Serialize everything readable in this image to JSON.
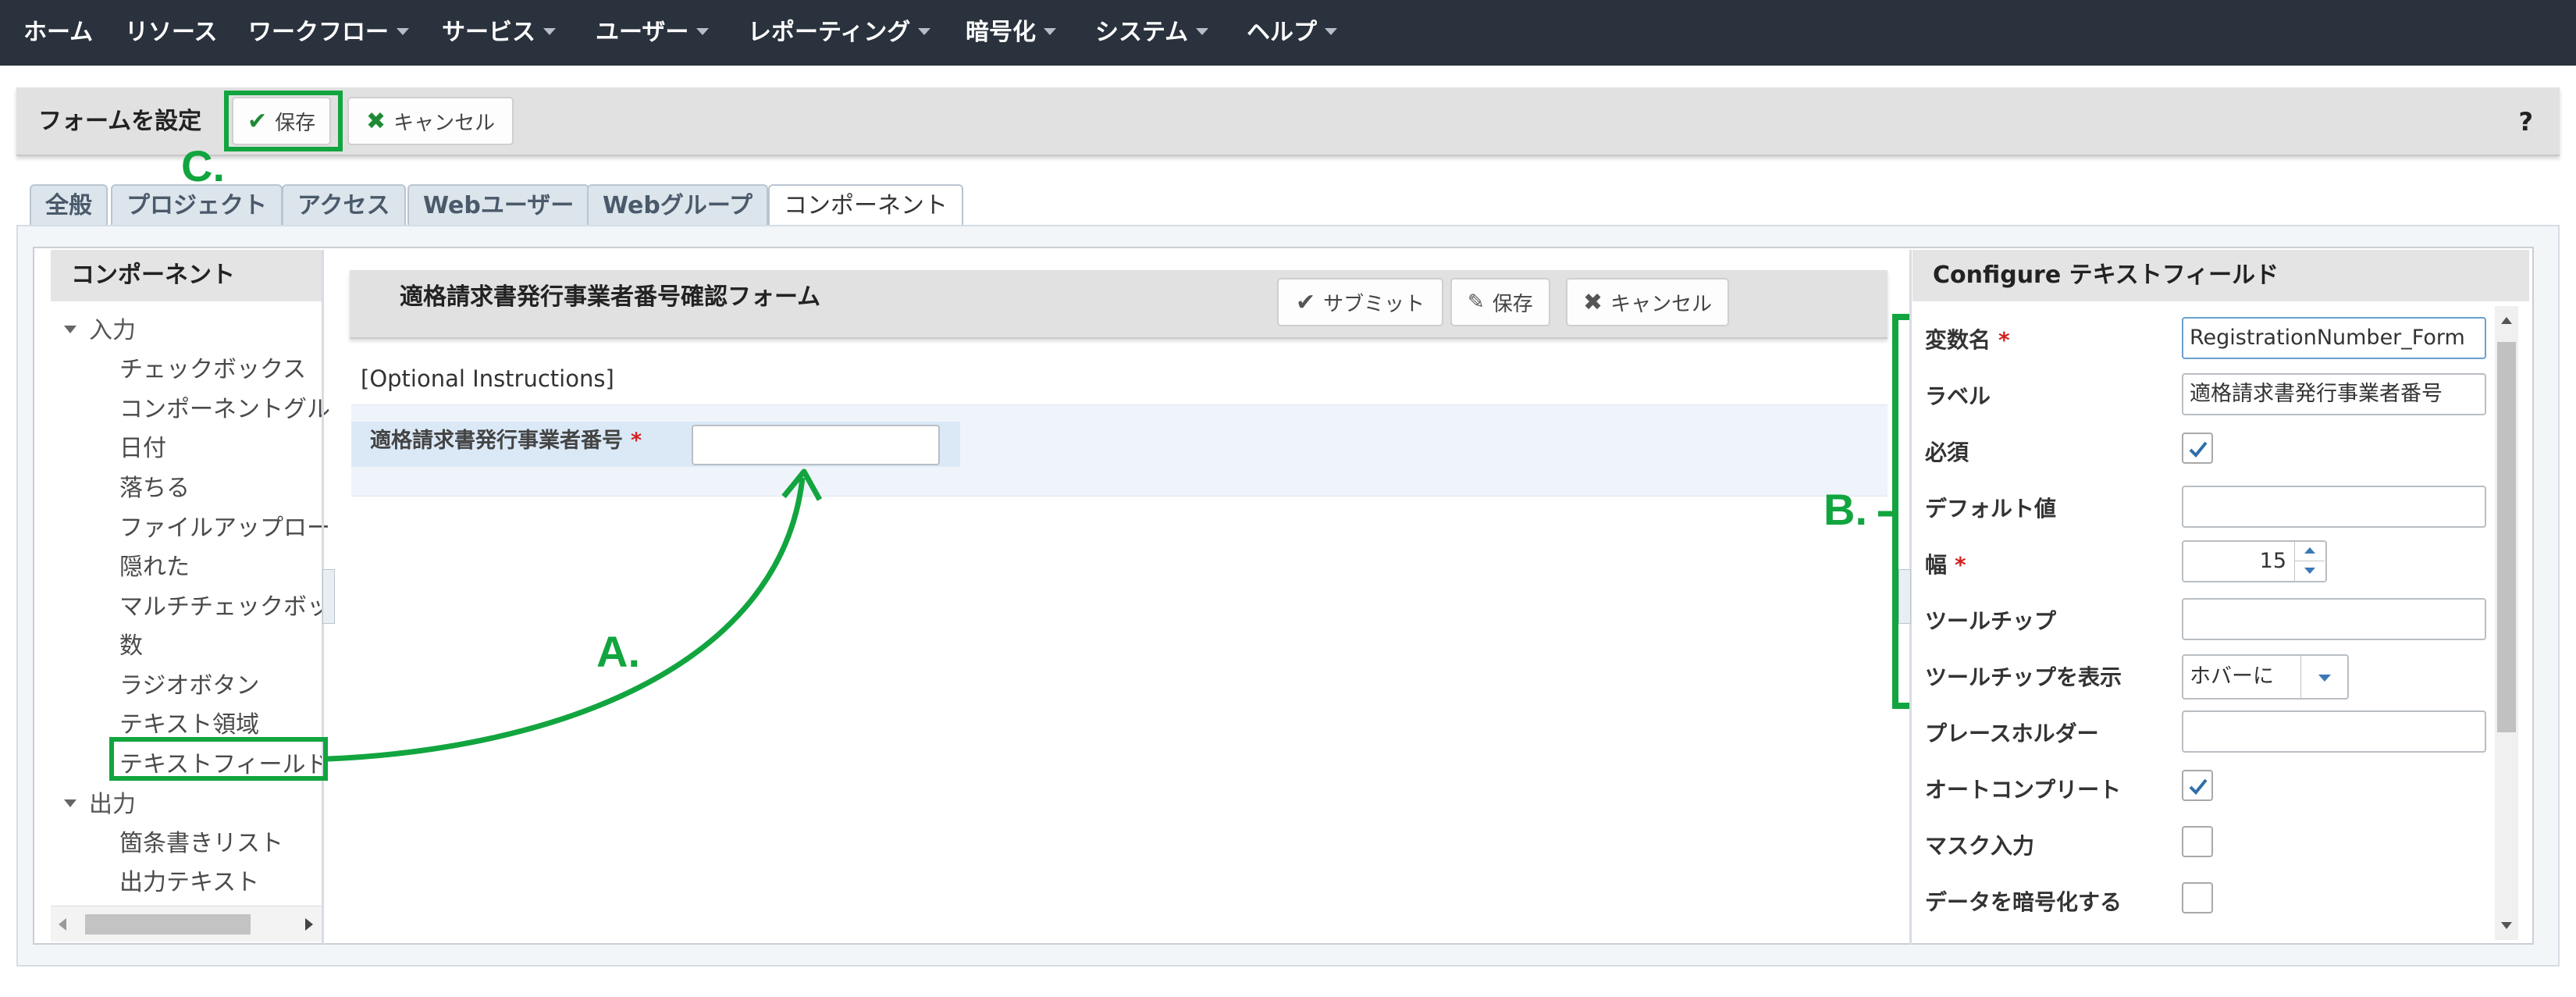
{
  "nav": {
    "items": [
      {
        "label": "ホーム",
        "dropdown": false
      },
      {
        "label": "リソース",
        "dropdown": false
      },
      {
        "label": "ワークフロー",
        "dropdown": true
      },
      {
        "label": "サービス",
        "dropdown": true
      },
      {
        "label": "ユーザー",
        "dropdown": true
      },
      {
        "label": "レポーティング",
        "dropdown": true
      },
      {
        "label": "暗号化",
        "dropdown": true
      },
      {
        "label": "システム",
        "dropdown": true
      },
      {
        "label": "ヘルプ",
        "dropdown": true
      }
    ]
  },
  "toolbar": {
    "title": "フォームを設定",
    "save_label": "保存",
    "cancel_label": "キャンセル",
    "help": "?"
  },
  "tabs": [
    {
      "label": "全般",
      "active": false
    },
    {
      "label": "プロジェクト",
      "active": false
    },
    {
      "label": "アクセス",
      "active": false
    },
    {
      "label": "Webユーザー",
      "active": false
    },
    {
      "label": "Webグループ",
      "active": false
    },
    {
      "label": "コンポーネント",
      "active": true
    }
  ],
  "components": {
    "header": "コンポーネント",
    "groups": [
      {
        "label": "入力",
        "items": [
          "チェックボックス",
          "コンポーネントグル",
          "日付",
          "落ちる",
          "ファイルアップロー",
          "隠れた",
          "マルチチェックボッ",
          "数",
          "ラジオボタン",
          "テキスト領域",
          "テキストフィールド"
        ]
      },
      {
        "label": "出力",
        "items": [
          "箇条書きリスト",
          "出力テキスト"
        ]
      }
    ]
  },
  "form": {
    "title": "適格請求書発行事業者番号確認フォーム",
    "submit_label": "サブミット",
    "save_label": "保存",
    "cancel_label": "キャンセル",
    "instructions": "[Optional Instructions]",
    "field_label": "適格請求書発行事業者番号",
    "required_mark": "*",
    "field_value": ""
  },
  "properties": {
    "header": "Configure テキストフィールド",
    "required_mark": "*",
    "variable_name_label": "変数名",
    "variable_name_value": "RegistrationNumber_Form",
    "label_label": "ラベル",
    "label_value": "適格請求書発行事業者番号",
    "required_label": "必須",
    "required_checked": true,
    "default_label": "デフォルト値",
    "default_value": "",
    "width_label": "幅",
    "width_value": "15",
    "tooltip_label": "ツールチップ",
    "tooltip_value": "",
    "show_tooltip_label": "ツールチップを表示",
    "show_tooltip_value": "ホバーに",
    "placeholder_label": "プレースホルダー",
    "placeholder_value": "",
    "autocomplete_label": "オートコンプリート",
    "autocomplete_checked": true,
    "mask_label": "マスク入力",
    "mask_checked": false,
    "encrypt_label": "データを暗号化する",
    "encrypt_checked": false
  },
  "annotations": {
    "a": "A.",
    "b": "B.",
    "c": "C.",
    "color": "#12a53f"
  },
  "colors": {
    "nav_bg": "#2a323d",
    "accent_green": "#12a53f",
    "checkbox_check": "#2f6fa8",
    "required_red": "#d41f1f"
  }
}
